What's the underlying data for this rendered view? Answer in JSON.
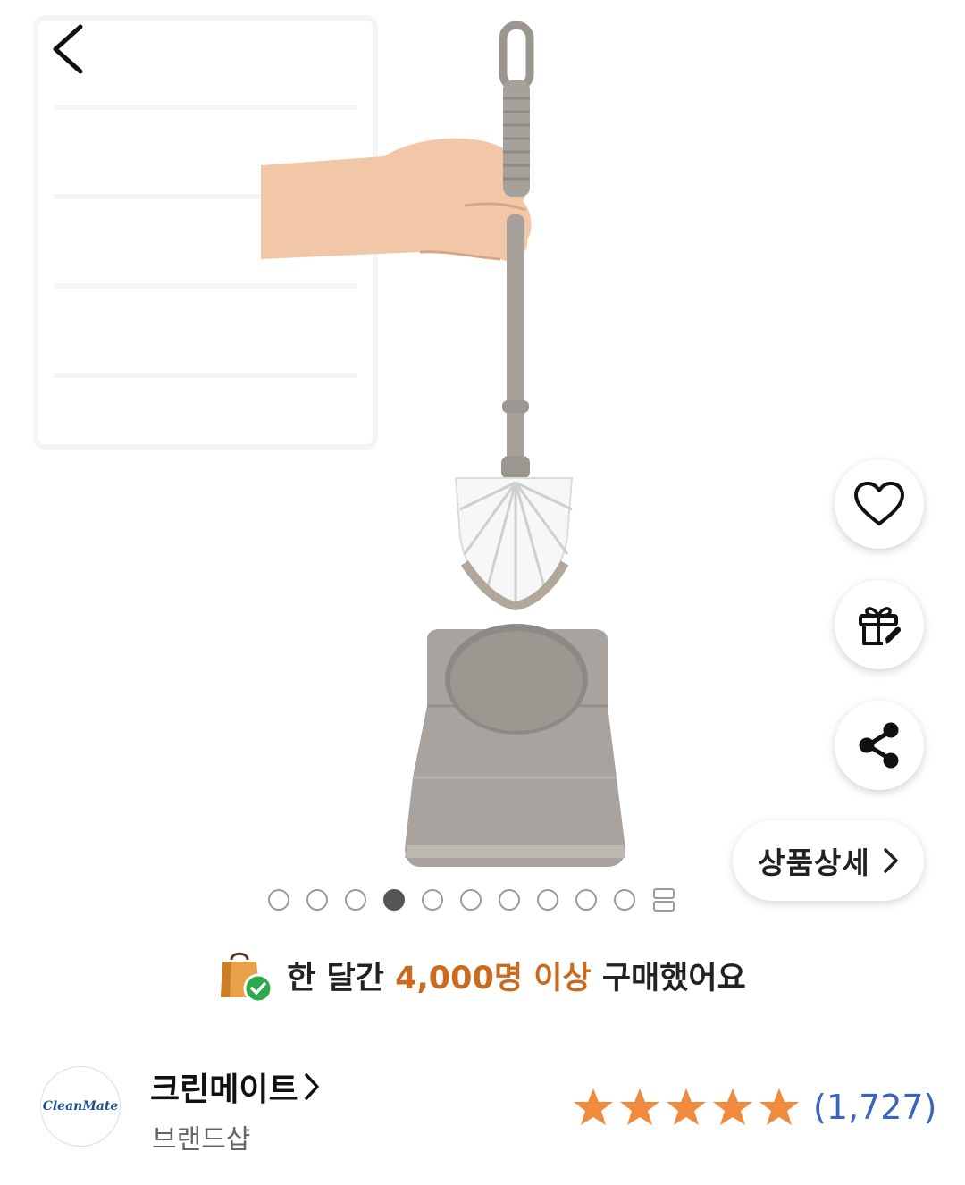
{
  "navigation": {
    "back_icon": "chevron-left-icon"
  },
  "actions": {
    "wishlist_icon": "heart-icon",
    "gift_icon": "gift-icon",
    "share_icon": "share-icon",
    "detail_label": "상품상세"
  },
  "carousel": {
    "total_dots": 10,
    "active_index": 3,
    "more_icon": "grid-more-icon"
  },
  "purchase_info": {
    "icon": "shopping-bag-check-icon",
    "prefix": "한 달간",
    "highlight": "4,000명 이상",
    "suffix": "구매했어요",
    "highlight_color": "#c96a1e"
  },
  "brand": {
    "logo_text": "CleanMate",
    "name": "크린메이트",
    "subtitle": "브랜드샵",
    "rating_stars": 5,
    "review_count": "(1,727)",
    "star_color": "#f08a3c",
    "count_color": "#3b64c0"
  }
}
